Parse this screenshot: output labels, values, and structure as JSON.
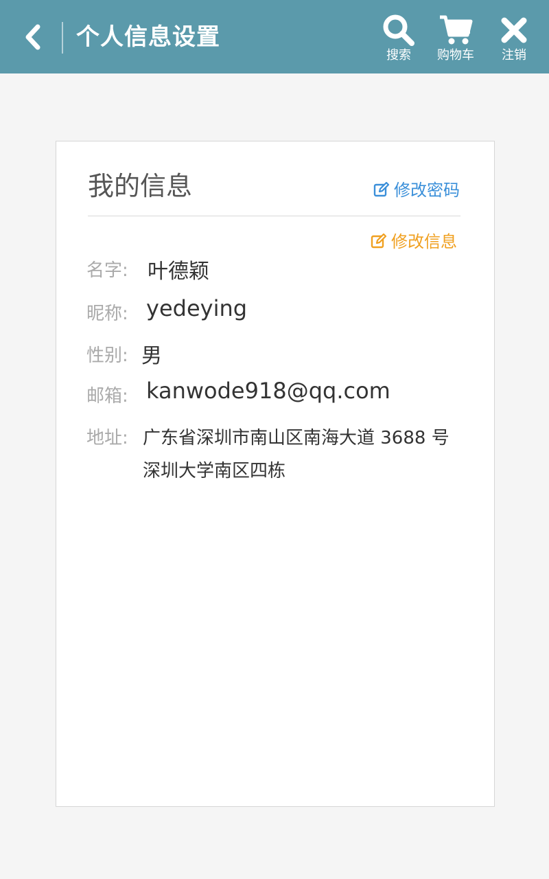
{
  "header": {
    "title": "个人信息设置",
    "actions": {
      "search_label": "搜索",
      "cart_label": "购物车",
      "logout_label": "注销"
    },
    "icons": [
      "chevron-left-icon",
      "search-icon",
      "cart-icon",
      "close-icon"
    ],
    "background_color": "#5b9aab"
  },
  "card": {
    "title": "我的信息",
    "change_password_label": "修改密码",
    "edit_info_label": "修改信息",
    "link_colors": {
      "change_password": "#3a8fd9",
      "edit_info": "#f0a020"
    },
    "fields": {
      "name": {
        "label": "名字:",
        "value": "叶德颖"
      },
      "nickname": {
        "label": "昵称:",
        "value": "yedeying"
      },
      "gender": {
        "label": "性别:",
        "value": "男"
      },
      "email": {
        "label": "邮箱:",
        "value": "kanwode918@qq.com"
      },
      "address": {
        "label": "地址:",
        "value": "广东省深圳市南山区南海大道 3688 号 深圳大学南区四栋"
      }
    }
  }
}
